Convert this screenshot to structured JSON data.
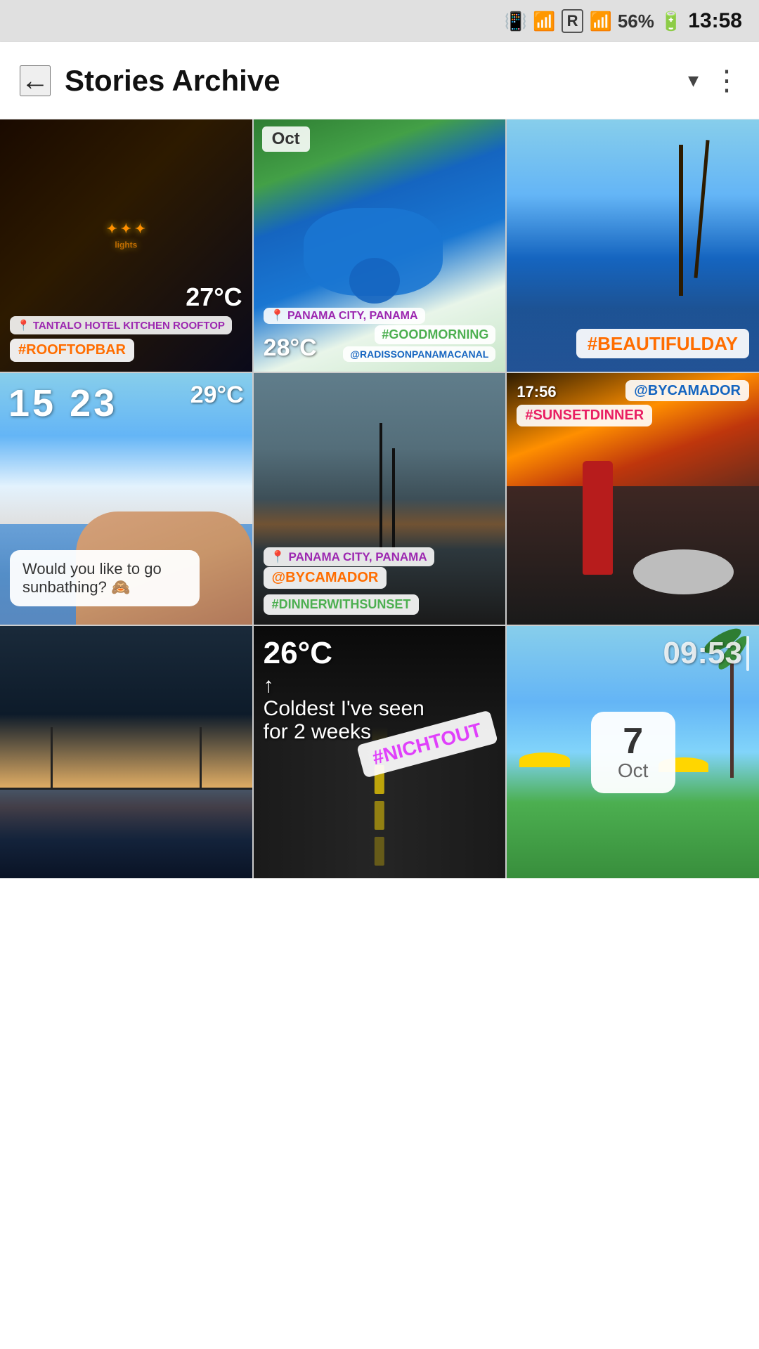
{
  "statusBar": {
    "time": "13:58",
    "battery": "56%",
    "icons": [
      "signal",
      "wifi",
      "roaming"
    ]
  },
  "appBar": {
    "backLabel": "←",
    "title": "Stories Archive",
    "dropdownIcon": "▾",
    "moreIcon": "⋮"
  },
  "grid": {
    "items": [
      {
        "id": "item-1",
        "photoClass": "photo-dark",
        "overlayContent": "rooftop-night",
        "temp": "27°C",
        "location": "📍 TANTALO HOTEL KITCHEN ROOFTOP",
        "hashtag": "#ROOFTOPBAR",
        "hashtagColor": "orange"
      },
      {
        "id": "item-2",
        "photoClass": "photo-pool",
        "overlayContent": "pool-day",
        "monthLabel": "Oct",
        "location": "📍 PANAMA CITY, PANAMA",
        "temp": "28°C",
        "hashtag": "#GOODMORNING",
        "handle": "@RADISSONPANAMACANAL"
      },
      {
        "id": "item-3",
        "photoClass": "photo-beach",
        "overlayContent": "beach",
        "hashtag": "#BEAUTIFULDAY",
        "hashtagColor": "orange"
      },
      {
        "id": "item-4",
        "photoClass": "photo-hotel-pool",
        "overlayContent": "hotel-pool",
        "time": "15 23",
        "temp": "29°C",
        "question": "Would you like to go sunbathing?"
      },
      {
        "id": "item-5",
        "photoClass": "photo-sunset-dock",
        "overlayContent": "sunset-dock",
        "location": "📍 PANAMA CITY, PANAMA",
        "handle": "@BYCAMADOR",
        "hashtag": "#DINNERWITHSUNSET"
      },
      {
        "id": "item-6",
        "photoClass": "photo-dinner",
        "overlayContent": "dinner",
        "sunsetDinnerTag": "#SUNSETDINNER",
        "handle": "@BYCAMADOR",
        "clockTime": "17:56"
      },
      {
        "id": "item-7",
        "photoClass": "photo-bridge-night",
        "overlayContent": "bridge-night"
      },
      {
        "id": "item-8",
        "photoClass": "photo-night-road",
        "overlayContent": "night-road",
        "temp26": "26°C",
        "nightout": "#NICHTOUT",
        "coldText": "Coldest I've seen\nfor 2 weeks"
      },
      {
        "id": "item-9",
        "photoClass": "photo-palm-pool",
        "overlayContent": "palm-pool",
        "dateBadge": {
          "day": "7",
          "month": "Oct"
        },
        "clockTime": "09:53"
      }
    ]
  }
}
